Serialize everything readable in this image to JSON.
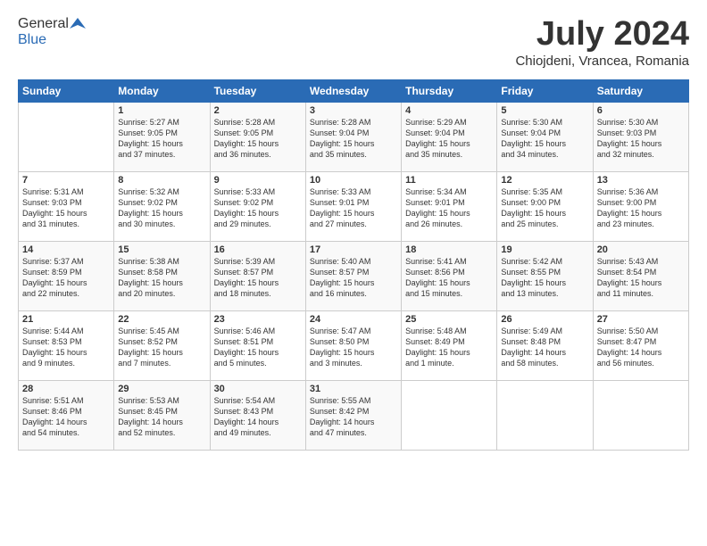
{
  "header": {
    "logo_line1": "General",
    "logo_line2": "Blue",
    "month_title": "July 2024",
    "location": "Chiojdeni, Vrancea, Romania"
  },
  "days_of_week": [
    "Sunday",
    "Monday",
    "Tuesday",
    "Wednesday",
    "Thursday",
    "Friday",
    "Saturday"
  ],
  "weeks": [
    [
      {
        "day": "",
        "content": ""
      },
      {
        "day": "1",
        "content": "Sunrise: 5:27 AM\nSunset: 9:05 PM\nDaylight: 15 hours\nand 37 minutes."
      },
      {
        "day": "2",
        "content": "Sunrise: 5:28 AM\nSunset: 9:05 PM\nDaylight: 15 hours\nand 36 minutes."
      },
      {
        "day": "3",
        "content": "Sunrise: 5:28 AM\nSunset: 9:04 PM\nDaylight: 15 hours\nand 35 minutes."
      },
      {
        "day": "4",
        "content": "Sunrise: 5:29 AM\nSunset: 9:04 PM\nDaylight: 15 hours\nand 35 minutes."
      },
      {
        "day": "5",
        "content": "Sunrise: 5:30 AM\nSunset: 9:04 PM\nDaylight: 15 hours\nand 34 minutes."
      },
      {
        "day": "6",
        "content": "Sunrise: 5:30 AM\nSunset: 9:03 PM\nDaylight: 15 hours\nand 32 minutes."
      }
    ],
    [
      {
        "day": "7",
        "content": "Sunrise: 5:31 AM\nSunset: 9:03 PM\nDaylight: 15 hours\nand 31 minutes."
      },
      {
        "day": "8",
        "content": "Sunrise: 5:32 AM\nSunset: 9:02 PM\nDaylight: 15 hours\nand 30 minutes."
      },
      {
        "day": "9",
        "content": "Sunrise: 5:33 AM\nSunset: 9:02 PM\nDaylight: 15 hours\nand 29 minutes."
      },
      {
        "day": "10",
        "content": "Sunrise: 5:33 AM\nSunset: 9:01 PM\nDaylight: 15 hours\nand 27 minutes."
      },
      {
        "day": "11",
        "content": "Sunrise: 5:34 AM\nSunset: 9:01 PM\nDaylight: 15 hours\nand 26 minutes."
      },
      {
        "day": "12",
        "content": "Sunrise: 5:35 AM\nSunset: 9:00 PM\nDaylight: 15 hours\nand 25 minutes."
      },
      {
        "day": "13",
        "content": "Sunrise: 5:36 AM\nSunset: 9:00 PM\nDaylight: 15 hours\nand 23 minutes."
      }
    ],
    [
      {
        "day": "14",
        "content": "Sunrise: 5:37 AM\nSunset: 8:59 PM\nDaylight: 15 hours\nand 22 minutes."
      },
      {
        "day": "15",
        "content": "Sunrise: 5:38 AM\nSunset: 8:58 PM\nDaylight: 15 hours\nand 20 minutes."
      },
      {
        "day": "16",
        "content": "Sunrise: 5:39 AM\nSunset: 8:57 PM\nDaylight: 15 hours\nand 18 minutes."
      },
      {
        "day": "17",
        "content": "Sunrise: 5:40 AM\nSunset: 8:57 PM\nDaylight: 15 hours\nand 16 minutes."
      },
      {
        "day": "18",
        "content": "Sunrise: 5:41 AM\nSunset: 8:56 PM\nDaylight: 15 hours\nand 15 minutes."
      },
      {
        "day": "19",
        "content": "Sunrise: 5:42 AM\nSunset: 8:55 PM\nDaylight: 15 hours\nand 13 minutes."
      },
      {
        "day": "20",
        "content": "Sunrise: 5:43 AM\nSunset: 8:54 PM\nDaylight: 15 hours\nand 11 minutes."
      }
    ],
    [
      {
        "day": "21",
        "content": "Sunrise: 5:44 AM\nSunset: 8:53 PM\nDaylight: 15 hours\nand 9 minutes."
      },
      {
        "day": "22",
        "content": "Sunrise: 5:45 AM\nSunset: 8:52 PM\nDaylight: 15 hours\nand 7 minutes."
      },
      {
        "day": "23",
        "content": "Sunrise: 5:46 AM\nSunset: 8:51 PM\nDaylight: 15 hours\nand 5 minutes."
      },
      {
        "day": "24",
        "content": "Sunrise: 5:47 AM\nSunset: 8:50 PM\nDaylight: 15 hours\nand 3 minutes."
      },
      {
        "day": "25",
        "content": "Sunrise: 5:48 AM\nSunset: 8:49 PM\nDaylight: 15 hours\nand 1 minute."
      },
      {
        "day": "26",
        "content": "Sunrise: 5:49 AM\nSunset: 8:48 PM\nDaylight: 14 hours\nand 58 minutes."
      },
      {
        "day": "27",
        "content": "Sunrise: 5:50 AM\nSunset: 8:47 PM\nDaylight: 14 hours\nand 56 minutes."
      }
    ],
    [
      {
        "day": "28",
        "content": "Sunrise: 5:51 AM\nSunset: 8:46 PM\nDaylight: 14 hours\nand 54 minutes."
      },
      {
        "day": "29",
        "content": "Sunrise: 5:53 AM\nSunset: 8:45 PM\nDaylight: 14 hours\nand 52 minutes."
      },
      {
        "day": "30",
        "content": "Sunrise: 5:54 AM\nSunset: 8:43 PM\nDaylight: 14 hours\nand 49 minutes."
      },
      {
        "day": "31",
        "content": "Sunrise: 5:55 AM\nSunset: 8:42 PM\nDaylight: 14 hours\nand 47 minutes."
      },
      {
        "day": "",
        "content": ""
      },
      {
        "day": "",
        "content": ""
      },
      {
        "day": "",
        "content": ""
      }
    ]
  ]
}
